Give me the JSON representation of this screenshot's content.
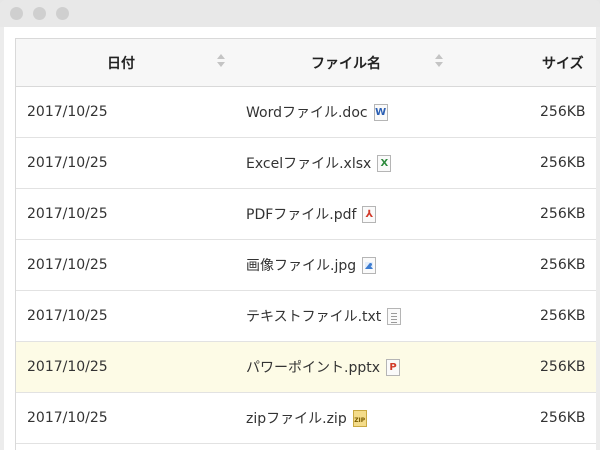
{
  "table": {
    "headers": {
      "date": "日付",
      "name": "ファイル名",
      "size": "サイズ"
    },
    "rows": [
      {
        "date": "2017/10/25",
        "name": "Wordファイル.doc",
        "size": "256KB",
        "icon": "word-file-icon",
        "glyph": "W"
      },
      {
        "date": "2017/10/25",
        "name": "Excelファイル.xlsx",
        "size": "256KB",
        "icon": "excel-file-icon",
        "glyph": "X"
      },
      {
        "date": "2017/10/25",
        "name": "PDFファイル.pdf",
        "size": "256KB",
        "icon": "pdf-file-icon",
        "glyph": "⅄"
      },
      {
        "date": "2017/10/25",
        "name": "画像ファイル.jpg",
        "size": "256KB",
        "icon": "image-file-icon",
        "glyph": ""
      },
      {
        "date": "2017/10/25",
        "name": "テキストファイル.txt",
        "size": "256KB",
        "icon": "text-file-icon",
        "glyph": ""
      },
      {
        "date": "2017/10/25",
        "name": "パワーポイント.pptx",
        "size": "256KB",
        "icon": "powerpoint-file-icon",
        "glyph": "P",
        "highlighted": true
      },
      {
        "date": "2017/10/25",
        "name": "zipファイル.zip",
        "size": "256KB",
        "icon": "zip-file-icon",
        "glyph": "ZIP"
      }
    ]
  },
  "colors": {
    "highlight_row": "#fdfbe6",
    "header_bg": "#f7f7f7",
    "border": "#d9d9d9"
  }
}
